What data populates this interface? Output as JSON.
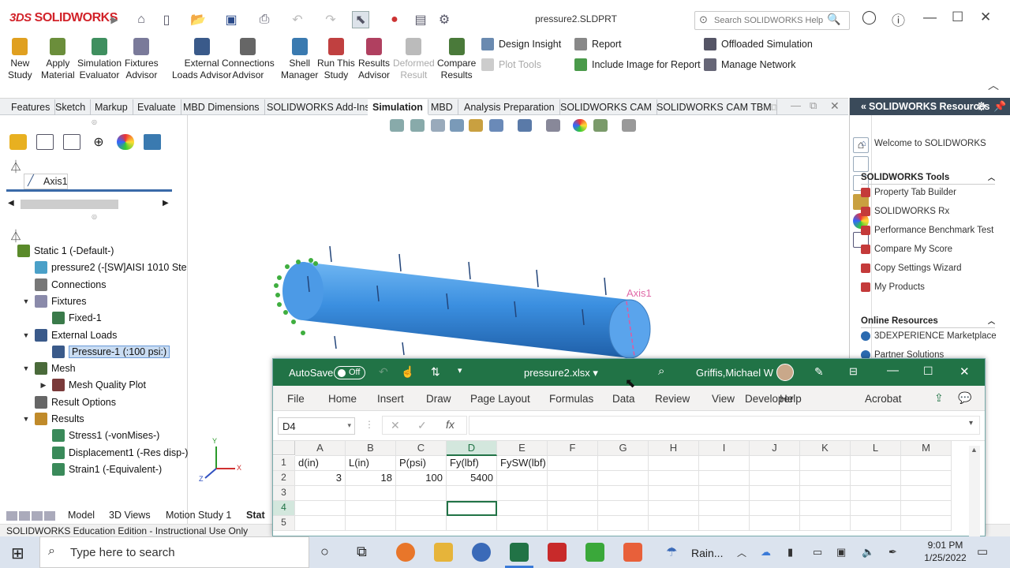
{
  "sw": {
    "logo_ds": "3DS",
    "logo_text": "SOLIDWORKS",
    "doc_title": "pressure2.SLDPRT",
    "search_placeholder": "Search SOLIDWORKS Help",
    "ribbon": [
      {
        "label": "New\nStudy",
        "color": "#e0a020"
      },
      {
        "label": "Apply\nMaterial",
        "color": "#6b8e3b"
      },
      {
        "label": "Simulation\nEvaluator",
        "color": "#3f8f5f"
      },
      {
        "label": "Fixtures\nAdvisor",
        "color": "#7a7a9a"
      },
      {
        "label": "External\nLoads Advisor",
        "color": "#3a5a8a"
      },
      {
        "label": "Connections\nAdvisor",
        "color": "#666"
      },
      {
        "label": "Shell\nManager",
        "color": "#3a7ab0"
      },
      {
        "label": "Run This\nStudy",
        "color": "#c04040"
      },
      {
        "label": "Results\nAdvisor",
        "color": "#b04060"
      },
      {
        "label": "Deformed\nResult",
        "color": "#bbb"
      },
      {
        "label": "Compare\nResults",
        "color": "#4a7a3a"
      }
    ],
    "ribbon_small": {
      "design_insight": "Design Insight",
      "plot_tools": "Plot Tools",
      "report": "Report",
      "include_image": "Include Image for Report",
      "offloaded": "Offloaded Simulation",
      "manage_network": "Manage Network"
    },
    "tabs": [
      "Features",
      "Sketch",
      "Markup",
      "Evaluate",
      "MBD Dimensions",
      "SOLIDWORKS Add-Ins",
      "Simulation",
      "MBD",
      "Analysis Preparation",
      "SOLIDWORKS CAM",
      "SOLIDWORKS CAM TBM"
    ],
    "active_tab": "Simulation",
    "axis_item": "Axis1",
    "tree": [
      {
        "label": "Static 1 (-Default-)",
        "indent": 0,
        "tw": "",
        "color": "#5a8a2a"
      },
      {
        "label": "pressure2 (-[SW]AISI 1010 Ste",
        "indent": 1,
        "tw": "",
        "color": "#4aa0c8"
      },
      {
        "label": "Connections",
        "indent": 1,
        "tw": "",
        "color": "#777"
      },
      {
        "label": "Fixtures",
        "indent": 1,
        "tw": "▼",
        "color": "#8a8aaa"
      },
      {
        "label": "Fixed-1",
        "indent": 2,
        "tw": "",
        "color": "#3a7a4a"
      },
      {
        "label": "External Loads",
        "indent": 1,
        "tw": "▼",
        "color": "#3a5a8a"
      },
      {
        "label": "Pressure-1 (:100 psi:)",
        "indent": 2,
        "tw": "",
        "color": "#3a5a8a",
        "selected": true
      },
      {
        "label": "Mesh",
        "indent": 1,
        "tw": "▼",
        "color": "#4a6a3a"
      },
      {
        "label": "Mesh Quality Plot",
        "indent": 2,
        "tw": "▶",
        "color": "#7a3a3a"
      },
      {
        "label": "Result Options",
        "indent": 1,
        "tw": "",
        "color": "#666"
      },
      {
        "label": "Results",
        "indent": 1,
        "tw": "▼",
        "color": "#c08a2a"
      },
      {
        "label": "Stress1 (-vonMises-)",
        "indent": 2,
        "tw": "",
        "color": "#3a8a5a"
      },
      {
        "label": "Displacement1 (-Res disp-)",
        "indent": 2,
        "tw": "",
        "color": "#3a8a5a"
      },
      {
        "label": "Strain1 (-Equivalent-)",
        "indent": 2,
        "tw": "",
        "color": "#3a8a5a"
      }
    ],
    "model_label": "Axis1",
    "triad": {
      "x": "X",
      "y": "Y",
      "z": "Z"
    },
    "bottom_tabs": [
      "Model",
      "3D Views",
      "Motion Study 1",
      "Stat"
    ],
    "status": "SOLIDWORKS Education Edition - Instructional Use Only",
    "resources": {
      "title": "SOLIDWORKS Resources",
      "welcome": "Welcome to SOLIDWORKS",
      "tools_header": "SOLIDWORKS Tools",
      "tools": [
        "Property Tab Builder",
        "SOLIDWORKS Rx",
        "Performance Benchmark Test",
        "Compare My Score",
        "Copy Settings Wizard",
        "My Products"
      ],
      "online_header": "Online Resources",
      "online": [
        "3DEXPERIENCE Marketplace",
        "Partner Solutions"
      ]
    }
  },
  "excel": {
    "autosave": "AutoSave",
    "toggle": "Off",
    "filename": "pressure2.xlsx",
    "user": "Griffis,Michael W",
    "menu": [
      "File",
      "Home",
      "Insert",
      "Draw",
      "Page Layout",
      "Formulas",
      "Data",
      "Review",
      "View",
      "Developer",
      "Help",
      "Acrobat"
    ],
    "namebox": "D4",
    "fx": "fx",
    "columns": [
      "A",
      "B",
      "C",
      "D",
      "E",
      "F",
      "G",
      "H",
      "I",
      "J",
      "K",
      "L",
      "M"
    ],
    "rows": [
      [
        "d(in)",
        "L(in)",
        "P(psi)",
        "Fy(lbf)",
        "FySW(lbf)",
        "",
        "",
        "",
        "",
        "",
        "",
        "",
        ""
      ],
      [
        "3",
        "18",
        "100",
        "5400",
        "",
        "",
        "",
        "",
        "",
        "",
        "",
        "",
        ""
      ],
      [
        "",
        "",
        "",
        "",
        "",
        "",
        "",
        "",
        "",
        "",
        "",
        "",
        ""
      ],
      [
        "",
        "",
        "",
        "",
        "",
        "",
        "",
        "",
        "",
        "",
        "",
        "",
        ""
      ],
      [
        "",
        "",
        "",
        "",
        "",
        "",
        "",
        "",
        "",
        "",
        "",
        "",
        ""
      ]
    ],
    "row_numbers": [
      "1",
      "2",
      "3",
      "4",
      "5"
    ],
    "active_cell": "D4",
    "accent": "#217346"
  },
  "taskbar": {
    "search": "Type here to search",
    "weather": "Rain...",
    "time": "9:01 PM",
    "date": "1/25/2022"
  }
}
